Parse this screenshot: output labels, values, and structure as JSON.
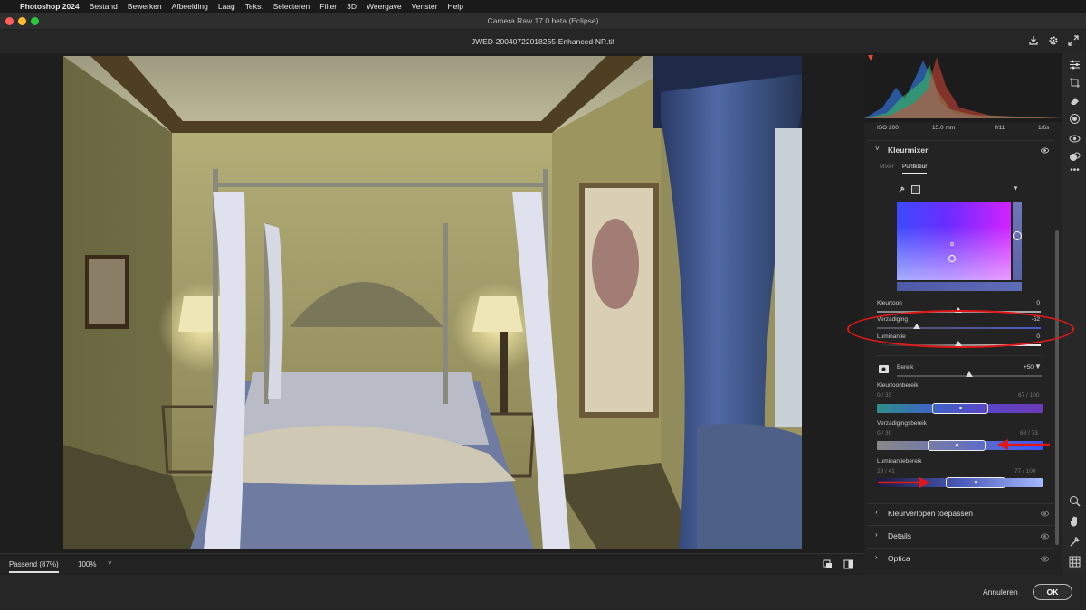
{
  "menubar": {
    "apple": "",
    "items": [
      "Photoshop 2024",
      "Bestand",
      "Bewerken",
      "Afbeelding",
      "Laag",
      "Tekst",
      "Selecteren",
      "Filter",
      "3D",
      "Weergave",
      "Venster",
      "Help"
    ]
  },
  "window": {
    "title": "Camera Raw 17.0 beta (Eclipse)",
    "filename": "JWED-20040722018265-Enhanced-NR.tif"
  },
  "colors": {
    "close": "#ff5f57",
    "minimize": "#febc2e",
    "zoom": "#28c840",
    "annotation": "#e01818",
    "accent": "#3a7bd5"
  },
  "icons": {
    "top": [
      "export-icon",
      "gear-icon",
      "fullscreen-icon"
    ],
    "tools": [
      "edit-sliders-icon",
      "crop-icon",
      "eraser-icon",
      "mask-icon",
      "redeye-icon",
      "presets-icon",
      "more-icon",
      "zoom-icon",
      "hand-icon",
      "eyedropper-icon",
      "grid-icon"
    ]
  },
  "bottombar": {
    "fit_label": "Passend (87%)",
    "zoom_value": "100%",
    "zoom_chevron": "˅"
  },
  "footer": {
    "cancel": "Annuleren",
    "ok": "OK"
  },
  "meta": {
    "iso": "ISO 200",
    "focal": "15.0 mm",
    "aperture": "f/11",
    "shutter": "1/6s"
  },
  "kleurmixer": {
    "title": "Kleurmixer",
    "tabs": [
      "Mixer",
      "Puntkleur"
    ],
    "active_tab": "Puntkleur",
    "sliders": [
      {
        "label": "Kleurtoon",
        "value": "0",
        "level": 0.5
      },
      {
        "label": "Verzadiging",
        "value": "-52",
        "level": 0.24
      },
      {
        "label": "Luminantie",
        "value": "0",
        "level": 0.5
      }
    ],
    "bereik": {
      "label": "Bereik",
      "value": "+50",
      "level": 0.75
    },
    "kleurtoonbereik": {
      "label": "Kleurtoonbereik",
      "left": "0 / 33",
      "right": "67 / 100"
    },
    "verzadigingsbereik": {
      "label": "Verzadigingsbereik",
      "left": "0 / 30",
      "right": "68 / 73"
    },
    "luminantiebereik": {
      "label": "Luminantiebereik",
      "left": "29 / 41",
      "right": "77 / 100"
    }
  },
  "sections": [
    "Kleurverlopen toepassen",
    "Details",
    "Optica"
  ]
}
